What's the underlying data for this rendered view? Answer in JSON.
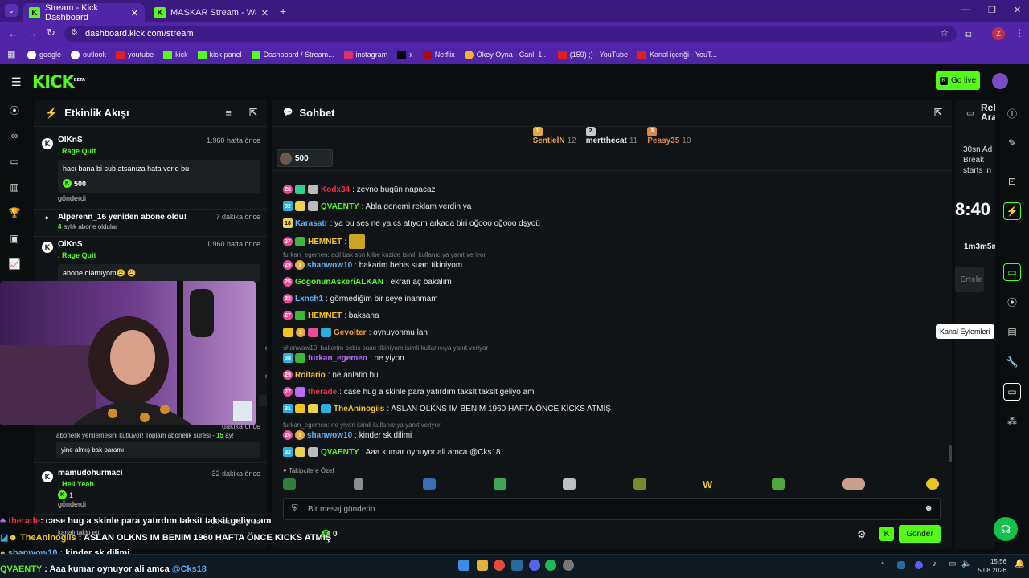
{
  "browser": {
    "tabs": [
      {
        "label": "Stream - Kick Dashboard",
        "active": true
      },
      {
        "label": "MASKAR Stream - Watch Live o",
        "active": false
      }
    ],
    "url": "dashboard.kick.com/stream",
    "profile_initial": "Z",
    "bookmarks": [
      "google",
      "outlook",
      "youtube",
      "kick",
      "kick panel",
      "Dashboard / Stream...",
      "instagram",
      "x",
      "Netflix",
      "Okey Oyna - Canlı 1...",
      "(159) ;) - YouTube",
      "Kanal içeriği - YouT..."
    ]
  },
  "kick_header": {
    "logo": "KICK",
    "beta": "BETA",
    "go_live": "Go live"
  },
  "activity": {
    "title": "Etkinlik Akışı",
    "events": [
      {
        "user": "OlKnS",
        "sub": ", Rage Quit",
        "time": "1.960 hafta önce",
        "message": "hacı bana bi sub atsanıza hata verio bu",
        "kicks": "500",
        "footer": "gönderdi"
      },
      {
        "user": "Alperenn_16 yeniden abone oldu!",
        "time": "7 dakika önce",
        "months": "4",
        "months_label": "aylık abone oldular"
      },
      {
        "user": "OlKnS",
        "sub": ", Rage Quit",
        "time": "1.960 hafta önce",
        "message": "abone olamıyom😩 😩"
      },
      {
        "time": "dakika önce",
        "text1": "abonelik yenilemesini kutluyor! Toplam abonelik süresi - ",
        "text1_num": "15",
        "text1_suffix": " ay!",
        "message": "yine almış bak paramı"
      },
      {
        "user": "mamudohurmaci",
        "sub": ", Hell Yeah",
        "time": "32 dakika önce",
        "kicks": "1",
        "footer": "gönderdi"
      },
      {
        "time": "26 dakika önce",
        "footer": "kanalı takip etti"
      }
    ]
  },
  "chat": {
    "title": "Sohbet",
    "top_chatters": [
      {
        "rank": "1",
        "name": "SentielN",
        "count": "12",
        "color": "#e9a93a"
      },
      {
        "rank": "2",
        "name": "mertthecat",
        "count": "11",
        "color": "#c8c8c8"
      },
      {
        "rank": "3",
        "name": "Peasy35",
        "count": "10",
        "color": "#d88a4e"
      }
    ],
    "pinned_kicks": "500",
    "messages": [
      {
        "badge": "26",
        "name": "Kodx34",
        "color": "#e8324a",
        "text": "zeyno bugün napacaz"
      },
      {
        "badge": "32",
        "name": "QVAENTY",
        "color": "#53fc18",
        "text": "Abla genemi reklam verdin ya"
      },
      {
        "badge": "18",
        "name": "Karasatr",
        "color": "#59b4ff",
        "text": "ya bu ses ne ya cs atıyom arkada biri oğooo oğooo dşyoü"
      },
      {
        "badge": "27",
        "name": "HEMNET",
        "color": "#f0c419",
        "text": ""
      },
      {
        "reply": "furkan_egemen: acil bak son klibe kuzide isimli kullanıcıya yanıt veriyor"
      },
      {
        "badge": "29",
        "name": "shanwow10",
        "color": "#59b4ff",
        "text": "bakarim bebis suan tikiniyom"
      },
      {
        "badge": "25",
        "name": "GogonunAskeriALKAN",
        "color": "#53fc18",
        "text": "ekran aç bakalım"
      },
      {
        "badge": "22",
        "name": "Lxnch1",
        "color": "#59b4ff",
        "text": "görmediğim bir seye inanmam"
      },
      {
        "badge": "27",
        "name": "HEMNET",
        "color": "#f0c419",
        "text": "baksana"
      },
      {
        "badge": "",
        "name": "Gevolter",
        "color": "#f0a030",
        "text": "oynuyonmu lan"
      },
      {
        "reply": "shanwow10: bakarim bebis suan tikiniyom isimli kullanıcıya yanıt veriyor"
      },
      {
        "badge": "38",
        "name": "furkan_egemen",
        "color": "#b96bff",
        "text": "ne yiyon"
      },
      {
        "badge": "29",
        "name": "Roitario",
        "color": "#f0c419",
        "text": "ne anlatio bu"
      },
      {
        "badge": "27",
        "name": "therade",
        "color": "#e8324a",
        "text": "case hug a skinle para yatırdım taksit taksit geliyo am"
      },
      {
        "badge": "31",
        "name": "TheAninogiis",
        "color": "#f0c419",
        "text": "ASLAN OLKNS IM BENIM 1960 HAFTA ÖNCE KİCKS ATMIŞ"
      },
      {
        "reply": "furkan_egemen: ne yiyon isimli kullanıcıya yanıt veriyor"
      },
      {
        "badge": "26",
        "name": "shanwow10",
        "color": "#59b4ff",
        "text": "kinder sk dilimi"
      },
      {
        "badge": "32",
        "name": "QVAENTY",
        "color": "#53fc18",
        "text": "Aaa kumar oynuyor ali amca @Cks18"
      }
    ],
    "followers_only": "Takipçilere Özel",
    "input_placeholder": "Bir mesaj gönderin",
    "points": "0",
    "send": "Gönder"
  },
  "right_panel": {
    "title": "Rel Ara",
    "ad_text": "30sn Ad Break starts in",
    "timer": "8:40",
    "duration": "1m3m5m",
    "snooze": "Ertele",
    "tooltip": "Kanal Eylemleri"
  },
  "overlay": [
    {
      "name": "therade",
      "text": ": case hug a skinle para yatırdım taksit taksit geliyo am",
      "color": "#e8324a"
    },
    {
      "name": "TheAninogiis",
      "text": " : ASLAN OLKNS IM BENIM 1960 HAFTA ÖNCE KICKS ATMIŞ",
      "color": "#f0c419"
    },
    {
      "name": "shanwow10",
      "text": " : kinder sk dilimi",
      "color": "#59b4ff"
    },
    {
      "name": "QVAENTY",
      "text": " : Aaa kumar oynuyor ali amca ",
      "mention": "@Cks18",
      "color": "#53fc18"
    }
  ],
  "taskbar": {
    "time": "15:56",
    "date": "5.08.2026"
  }
}
